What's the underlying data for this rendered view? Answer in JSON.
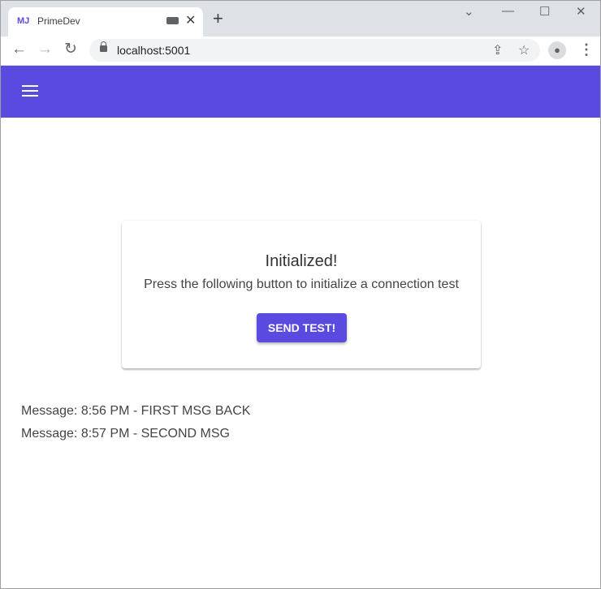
{
  "browser": {
    "tab_title": "PrimeDev",
    "tab_logo": "MJ",
    "url": "localhost:5001",
    "icons": [
      "back-icon",
      "forward-icon",
      "reload-icon",
      "lock-icon",
      "share-icon",
      "star-icon",
      "profile-icon",
      "more-icon",
      "gamepad-icon",
      "close-icon",
      "new-tab-icon"
    ]
  },
  "app": {
    "accent": "#5b4ae0"
  },
  "card": {
    "title": "Initialized!",
    "description": "Press the following button to initialize a connection test",
    "button_label": "SEND TEST!"
  },
  "messages": [
    "Message: 8:56 PM - FIRST MSG BACK",
    "Message: 8:57 PM - SECOND MSG"
  ]
}
